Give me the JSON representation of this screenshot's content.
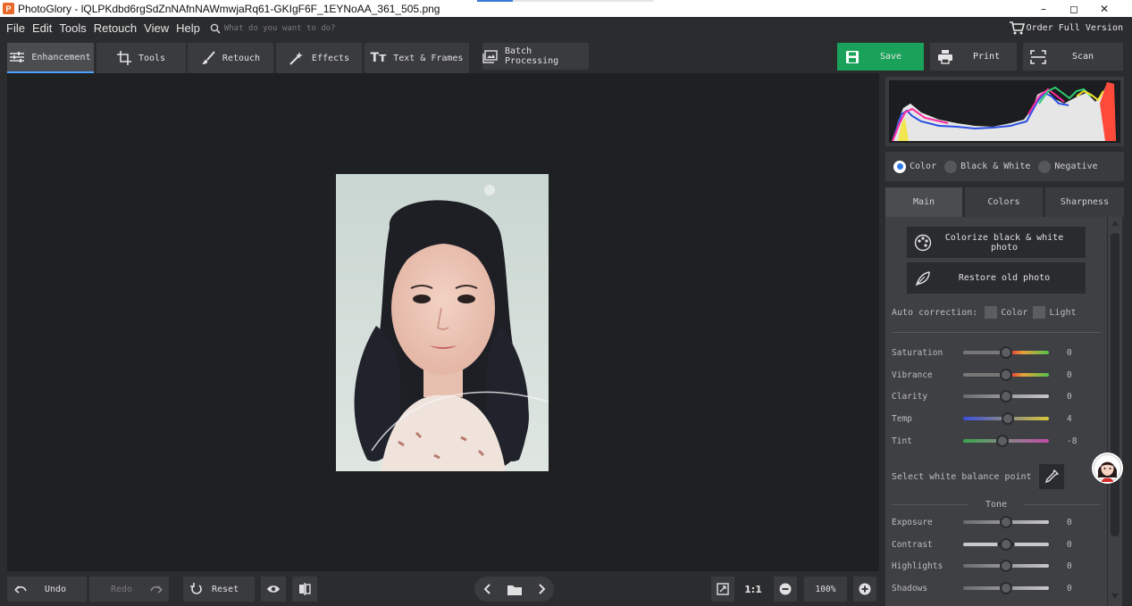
{
  "window": {
    "app_icon_letter": "P",
    "title": "PhotoGlory - lQLPKdbd6rgSdZnNAfnNAWmwjaRq61-GKIgF6F_1EYNoAA_361_505.png",
    "minimize": "–",
    "maximize": "◻",
    "close": "✕"
  },
  "menu": {
    "items": [
      "File",
      "Edit",
      "Tools",
      "Retouch",
      "View",
      "Help"
    ],
    "search_placeholder": "What do you want to do?",
    "order_label": "Order Full Version"
  },
  "toolbar": {
    "tabs": [
      {
        "label": "Enhancement",
        "icon": "sliders-icon"
      },
      {
        "label": "Tools",
        "icon": "crop-icon"
      },
      {
        "label": "Retouch",
        "icon": "brush-icon"
      },
      {
        "label": "Effects",
        "icon": "magic-wand-icon"
      },
      {
        "label": "Text & Frames",
        "icon": "text-icon"
      },
      {
        "label": "Batch Processing",
        "icon": "batch-icon"
      }
    ],
    "save_label": "Save",
    "print_label": "Print",
    "scan_label": "Scan"
  },
  "bottom": {
    "undo_label": "Undo",
    "redo_label": "Redo",
    "reset_label": "Reset",
    "zoom_ratio": "1:1",
    "zoom_value": "100%"
  },
  "panel": {
    "modes": [
      {
        "label": "Color",
        "selected": true
      },
      {
        "label": "Black & White",
        "selected": false
      },
      {
        "label": "Negative",
        "selected": false
      }
    ],
    "tabs": [
      "Main",
      "Colors",
      "Sharpness"
    ],
    "colorize_label": "Colorize black & white photo",
    "restore_label": "Restore old photo",
    "auto_correction_label": "Auto correction:",
    "auto_color_label": "Color",
    "auto_light_label": "Light",
    "sliders": [
      {
        "label": "Saturation",
        "value": "0",
        "level": 0.5
      },
      {
        "label": "Vibrance",
        "value": "0",
        "level": 0.5
      },
      {
        "label": "Clarity",
        "value": "0",
        "level": 0.5
      },
      {
        "label": "Temp",
        "value": "4",
        "level": 0.52
      },
      {
        "label": "Tint",
        "value": "-8",
        "level": 0.46
      }
    ],
    "white_balance_label": "Select white balance point",
    "tone_label": "Tone",
    "tone_sliders": [
      {
        "label": "Exposure",
        "value": "0",
        "level": 0.5
      },
      {
        "label": "Contrast",
        "value": "0",
        "level": 0.5
      },
      {
        "label": "Highlights",
        "value": "0",
        "level": 0.5
      },
      {
        "label": "Shadows",
        "value": "0",
        "level": 0.5
      }
    ]
  },
  "colors": {
    "save_green": "#1aa25a",
    "active_tab_underline": "#4aa3ff",
    "radio_selected": "#2c7be5"
  }
}
